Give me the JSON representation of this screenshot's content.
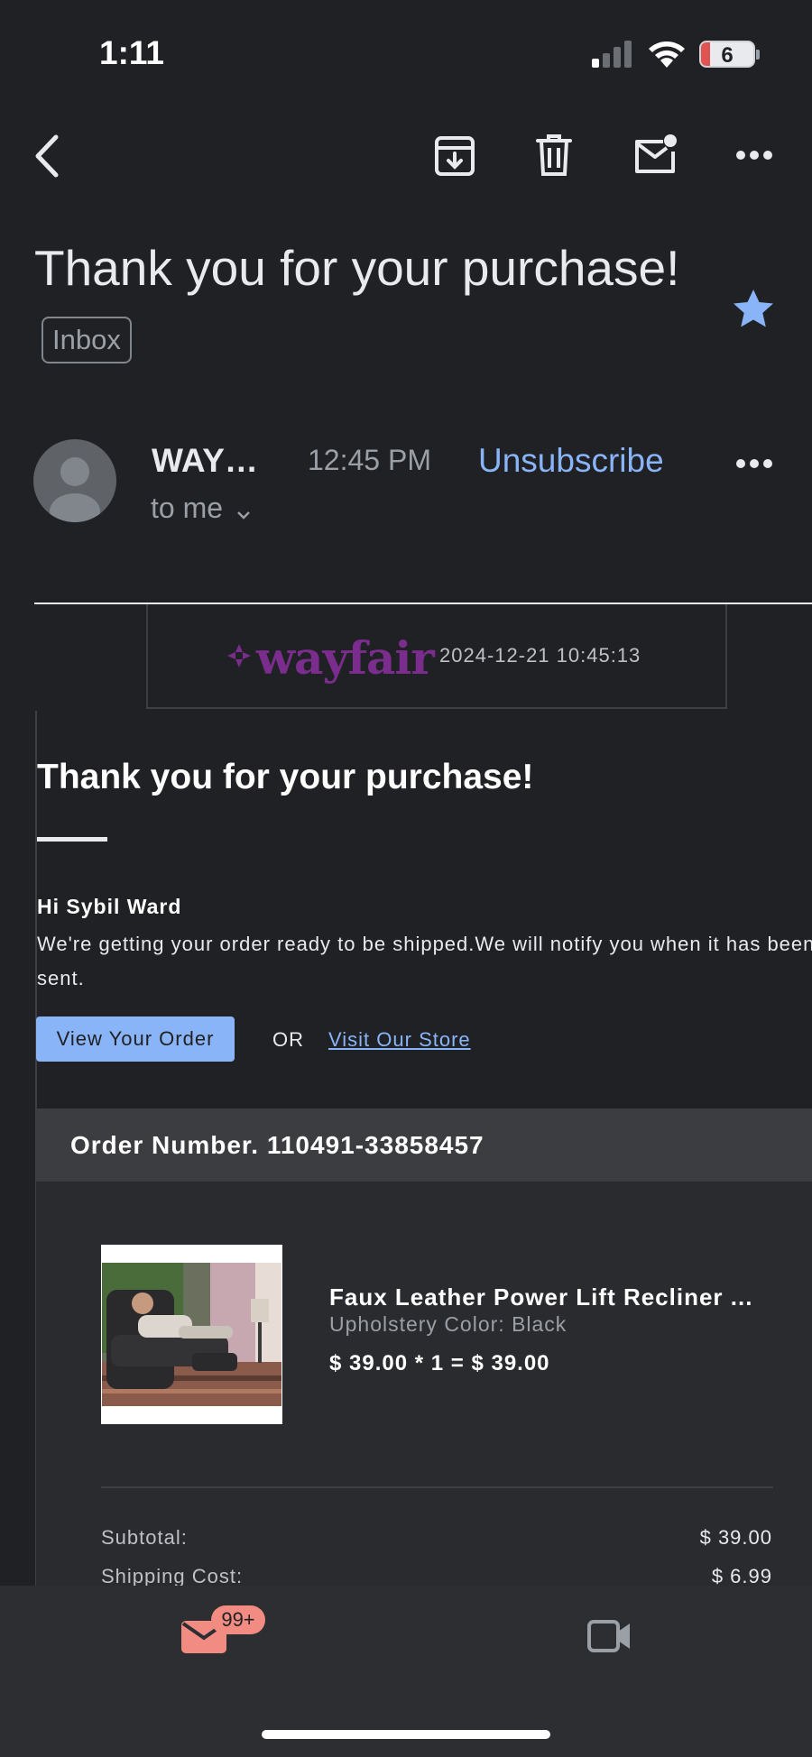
{
  "status_bar": {
    "time": "1:11",
    "battery_level": "6"
  },
  "toolbar": {
    "back": "back",
    "archive": "archive",
    "delete": "delete",
    "mark_unread": "mark unread",
    "more": "more"
  },
  "email": {
    "subject": "Thank you for your purchase!",
    "label": "Inbox",
    "starred": true,
    "sender": "WAY…",
    "time": "12:45 PM",
    "unsubscribe": "Unsubscribe",
    "recipient": "to me"
  },
  "message": {
    "brand": "wayfair",
    "timestamp": "2024-12-21 10:45:13",
    "headline": "Thank you for your purchase!",
    "greeting": "Hi Sybil Ward",
    "body": "We're getting your order ready to be shipped.We will notify you when it has been sent.",
    "view_order": "View Your Order",
    "or": "OR",
    "visit_store": "Visit Our Store",
    "order_number": "Order Number. 110491-33858457",
    "item": {
      "name": "Faux Leather Power Lift Recliner ...",
      "option": "Upholstery Color: Black",
      "price_line": "$ 39.00 * 1 = $ 39.00"
    },
    "totals": [
      {
        "label": "Subtotal:",
        "value": "$ 39.00"
      },
      {
        "label": "Shipping Cost:",
        "value": "$ 6.99"
      }
    ]
  },
  "bottom_nav": {
    "mail_badge": "99+"
  },
  "colors": {
    "background": "#202124",
    "accent": "#8ab4f8",
    "star": "#8ab4f8",
    "brand": "#7b2d8e",
    "badge": "#f28b82"
  }
}
